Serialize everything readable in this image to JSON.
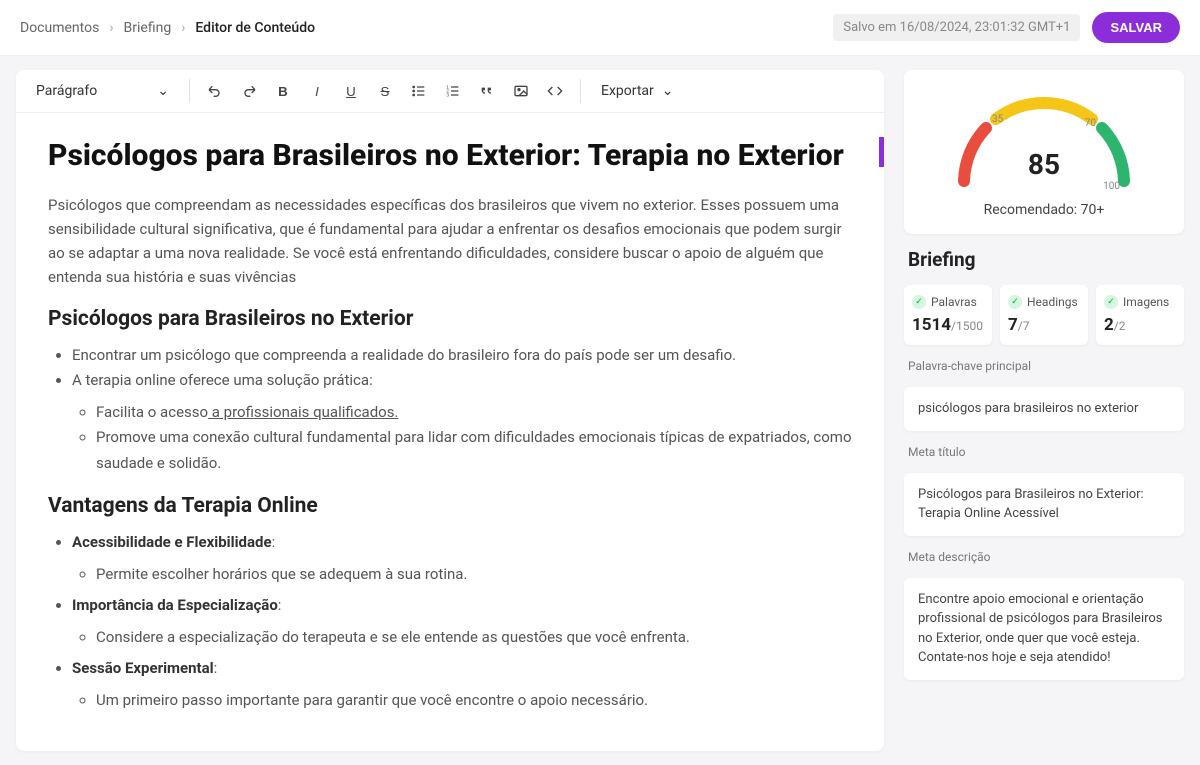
{
  "breadcrumb": {
    "root": "Documentos",
    "mid": "Briefing",
    "current": "Editor de Conteúdo"
  },
  "saved": "Salvo em 16/08/2024, 23:01:32 GMT+1",
  "save_btn": "SALVAR",
  "format_label": "Parágrafo",
  "export_label": "Exportar",
  "doc": {
    "h1": "Psicólogos para Brasileiros no Exterior: Terapia no Exterior",
    "intro": "Psicólogos que compreendam as necessidades específicas dos brasileiros que vivem no exterior. Esses possuem uma sensibilidade cultural significativa, que é fundamental para ajudar a enfrentar os desafios emocionais que podem surgir ao se adaptar a uma nova realidade. Se você está enfrentando dificuldades, considere buscar o apoio de alguém que entenda sua história e suas vivências",
    "h2a": "Psicólogos para Brasileiros no Exterior",
    "li1": "Encontrar um psicólogo que compreenda a realidade do brasileiro fora do país pode ser um desafio.",
    "li2": "A terapia online oferece uma solução prática:",
    "li2a_pre": "Facilita o acesso",
    "li2a_link": " a profissionais qualificados.",
    "li2b": "Promove uma conexão cultural fundamental para lidar com dificuldades emocionais típicas de expatriados, como saudade e solidão.",
    "h2b": "Vantagens da Terapia Online",
    "li3": "Acessibilidade e Flexibilidade",
    "li3a": "Permite escolher horários que se adequem à sua rotina.",
    "li4": "Importância da Especialização",
    "li4a": "Considere a especialização do terapeuta e se ele entende as questões que você enfrenta.",
    "li5": "Sessão Experimental",
    "li5a": "Um primeiro passo importante para garantir que você encontre o apoio necessário."
  },
  "gauge": {
    "score": "85",
    "t35": "35",
    "t70": "70",
    "t100": "100",
    "recommended": "Recomendado: 70+"
  },
  "briefing_title": "Briefing",
  "stats": {
    "words_label": "Palavras",
    "words_val": "1514",
    "words_max": "/1500",
    "headings_label": "Headings",
    "headings_val": "7",
    "headings_max": "/7",
    "images_label": "Imagens",
    "images_val": "2",
    "images_max": "/2"
  },
  "kw_label": "Palavra-chave principal",
  "kw_value": "psicólogos para brasileiros no exterior",
  "metatitle_label": "Meta título",
  "metatitle_value": "Psicólogos para Brasileiros no Exterior: Terapia Online Acessível",
  "metadesc_label": "Meta descrição",
  "metadesc_value": "Encontre apoio emocional e orientação profissional de psicólogos para Brasileiros no Exterior, onde quer que você esteja. Contate-nos hoje e seja atendido!"
}
